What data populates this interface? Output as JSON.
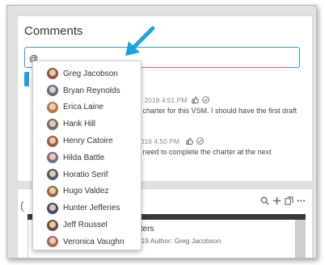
{
  "comments": {
    "title": "Comments",
    "input_value": "@",
    "entries": [
      {
        "timestamp": "6, 2019 4:51 PM",
        "text": "e charter for this VSM. I should have the first draft"
      },
      {
        "timestamp": "2019 4:50 PM",
        "text": "e need to complete the charter at the next"
      }
    ]
  },
  "mention_list": [
    {
      "name": "Greg Jacobson",
      "color": "#8a5a3c"
    },
    {
      "name": "Bryan Reynolds",
      "color": "#5b6e8a"
    },
    {
      "name": "Erica Laine",
      "color": "#b07a4f"
    },
    {
      "name": "Hank Hill",
      "color": "#6d6d6d"
    },
    {
      "name": "Henry Catoire",
      "color": "#9a5d3f"
    },
    {
      "name": "Hilda Battle",
      "color": "#7c6a8e"
    },
    {
      "name": "Horatio Serif",
      "color": "#4e5a66"
    },
    {
      "name": "Hugo Valdez",
      "color": "#8b6b4a"
    },
    {
      "name": "Hunter Jefferies",
      "color": "#3f4d6b"
    },
    {
      "name": "Jeff Roussel",
      "color": "#6a5040"
    },
    {
      "name": "Veronica Vaughn",
      "color": "#a36b5c"
    }
  ],
  "bottom_panel": {
    "left_glyph": "(",
    "card_title": "orters",
    "card_meta": "2019   Author: Greg Jacobson"
  },
  "colors": {
    "accent": "#2a9fd6",
    "arrow": "#1fa3dc"
  },
  "icons": {
    "like": "thumbs-up-icon",
    "check": "check-circle-icon",
    "search": "search-icon",
    "add": "plus-icon",
    "copy": "copy-icon",
    "more": "more-icon"
  }
}
